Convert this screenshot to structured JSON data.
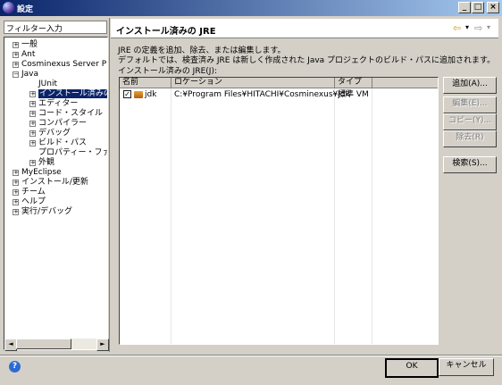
{
  "window": {
    "title": "設定",
    "controls": {
      "minimize": "_",
      "maximize": "□",
      "close": "×"
    }
  },
  "sidebar": {
    "filter_placeholder": "フィルター入力",
    "tree": [
      {
        "label": "一般",
        "expander": "+"
      },
      {
        "label": "Ant",
        "expander": "+"
      },
      {
        "label": "Cosminexus Server Plu",
        "expander": "+"
      },
      {
        "label": "Java",
        "expander": "−"
      },
      {
        "label": "JUnit",
        "expander": ""
      },
      {
        "label": "インストール済みの J",
        "expander": "+"
      },
      {
        "label": "エディター",
        "expander": "+"
      },
      {
        "label": "コード・スタイル",
        "expander": "+"
      },
      {
        "label": "コンパイラー",
        "expander": "+"
      },
      {
        "label": "デバッグ",
        "expander": "+"
      },
      {
        "label": "ビルド・パス",
        "expander": "+"
      },
      {
        "label": "プロパティー・ファイル・",
        "expander": ""
      },
      {
        "label": "外観",
        "expander": "+"
      },
      {
        "label": "MyEclipse",
        "expander": "+"
      },
      {
        "label": "インストール/更新",
        "expander": "+"
      },
      {
        "label": "チーム",
        "expander": "+"
      },
      {
        "label": "ヘルプ",
        "expander": "+"
      },
      {
        "label": "実行/デバッグ",
        "expander": "+"
      }
    ],
    "scroll_left": "◄",
    "scroll_right": "►"
  },
  "page": {
    "title": "インストール済みの JRE",
    "nav": {
      "back": "⇦",
      "back_menu": "▾",
      "forward": "⇨",
      "forward_menu": "▾"
    },
    "description_line1": "JRE の定義を追加、除去、または編集します。",
    "description_line2": "デフォルトでは、検査済み JRE は新しく作成された Java プロジェクトのビルド・パスに追加されます。",
    "table_label": "インストール済みの JRE(J):",
    "columns": [
      "名前",
      "ロケーション",
      "タイプ"
    ],
    "rows": [
      {
        "checked": "✓",
        "name": "jdk",
        "location": "C:¥Program Files¥HITACHI¥Cosminexus¥jdk",
        "type": "標準 VM"
      }
    ],
    "buttons": {
      "add": "追加(A)...",
      "edit": "編集(E)...",
      "copy": "コピー(Y)...",
      "remove": "除去(R)",
      "search": "検索(S)..."
    }
  },
  "footer": {
    "help": "?",
    "ok": "OK",
    "cancel": "キャンセル"
  }
}
